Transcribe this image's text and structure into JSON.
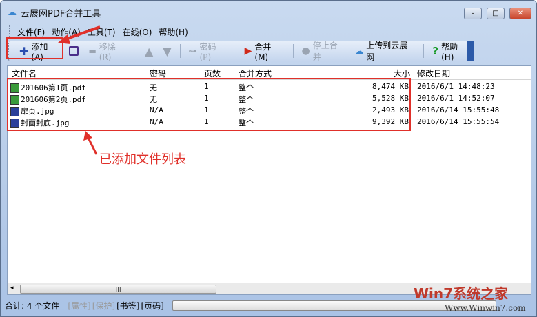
{
  "window": {
    "title": "云展网PDF合并工具",
    "minimize": "–",
    "maximize": "□",
    "close": "✕"
  },
  "menu": [
    "文件(F)",
    "动作(A)",
    "工具(T)",
    "在线(O)",
    "帮助(H)"
  ],
  "toolbar": {
    "add": "添加(A)",
    "remove": "移除(R)",
    "password": "密码(P)",
    "merge": "合并(M)",
    "stop": "停止合并",
    "upload": "上传到云展网",
    "help": "帮助(H)"
  },
  "columns": [
    "文件名",
    "密码",
    "页数",
    "合并方式",
    "大小",
    "修改日期"
  ],
  "files": [
    {
      "name": "201606第1页.pdf",
      "password": "无",
      "pages": "1",
      "mode": "整个",
      "size": "8,474 KB",
      "date": "2016/6/1 14:48:23",
      "type": "pdf"
    },
    {
      "name": "201606第2页.pdf",
      "password": "无",
      "pages": "1",
      "mode": "整个",
      "size": "5,528 KB",
      "date": "2016/6/1 14:52:07",
      "type": "pdf"
    },
    {
      "name": "扉页.jpg",
      "password": "N/A",
      "pages": "1",
      "mode": "整个",
      "size": "2,493 KB",
      "date": "2016/6/14 15:55:48",
      "type": "pic"
    },
    {
      "name": "封面封底.jpg",
      "password": "N/A",
      "pages": "1",
      "mode": "整个",
      "size": "9,392 KB",
      "date": "2016/6/14 15:55:54",
      "type": "pic"
    }
  ],
  "status": {
    "total": "合计: 4 个文件",
    "attr": "[属性]",
    "protect": "[保护]",
    "bookmark": "[书签]",
    "pagenum": "[页码]"
  },
  "annotation": "已添加文件列表",
  "watermark": {
    "brand": "Win7系统之家",
    "url": "Www.Winwin7.com"
  },
  "colors": {
    "annotation": "#e0302a"
  }
}
